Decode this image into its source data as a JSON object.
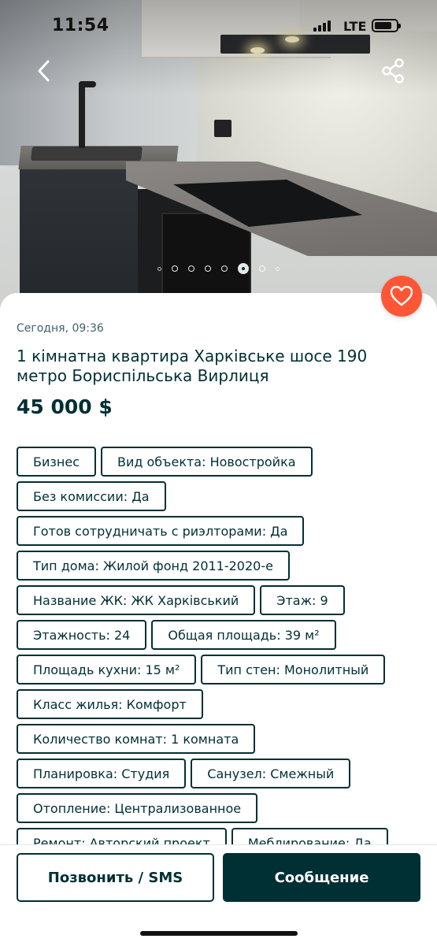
{
  "status_bar": {
    "time": "11:54",
    "network": "LTE",
    "battery_level": 0.8
  },
  "gallery": {
    "image": "kitchen-photo",
    "total_images": 8,
    "active_index": 5,
    "back_icon": "chevron-left-icon",
    "share_icon": "share-icon"
  },
  "favorite": {
    "icon": "heart-icon",
    "color": "#ff5636"
  },
  "listing": {
    "date": "Сегодня, 09:36",
    "title": "1 кімнатна квартира Харківське шосе 190 метро Бориспільська Вирлиця",
    "price": "45 000 $"
  },
  "tags": [
    "Бизнес",
    "Вид объекта: Новостройка",
    "Без комиссии: Да",
    "Готов сотрудничать с риэлторами: Да",
    "Тип дома: Жилой фонд 2011-2020-е",
    "Название ЖК: ЖК Харківський",
    "Этаж: 9",
    "Этажность: 24",
    "Общая площадь: 39 м²",
    "Площадь кухни: 15 м²",
    "Тип стен: Монолитный",
    "Класс жилья: Комфорт",
    "Количество комнат: 1 комната",
    "Планировка: Студия",
    "Санузел: Смежный",
    "Отопление: Централизованное",
    "Ремонт: Авторский проект",
    "Меблирование: Да"
  ],
  "actions": {
    "call_label": "Позвонить / SMS",
    "message_label": "Сообщение"
  },
  "colors": {
    "primary": "#002f34",
    "accent": "#ff5636",
    "muted_text": "#406367"
  }
}
